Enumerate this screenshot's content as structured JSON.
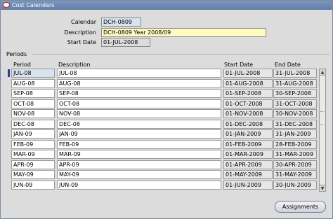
{
  "window": {
    "title": "Cost Calendars"
  },
  "form": {
    "calendar_label": "Calendar",
    "calendar_value": "DCH-0809",
    "description_label": "Description",
    "description_value": "DCH-0809 Year 2008/09",
    "start_date_label": "Start Date",
    "start_date_value": "01-JUL-2008"
  },
  "periods": {
    "section_label": "Periods",
    "columns": [
      "Period",
      "Description",
      "Start Date",
      "End Date"
    ],
    "rows": [
      {
        "period": "JUL-08",
        "description": "JUL-08",
        "start": "01-JUL-2008",
        "end": "31-JUL-2008"
      },
      {
        "period": "AUG-08",
        "description": "AUG-08",
        "start": "01-AUG-2008",
        "end": "31-AUG-2008"
      },
      {
        "period": "SEP-08",
        "description": "SEP-08",
        "start": "01-SEP-2008",
        "end": "30-SEP-2008"
      },
      {
        "period": "OCT-08",
        "description": "OCT-08",
        "start": "01-OCT-2008",
        "end": "31-OCT-2008"
      },
      {
        "period": "NOV-08",
        "description": "NOV-08",
        "start": "01-NOV-2008",
        "end": "30-NOV-2008"
      },
      {
        "period": "DEC-08",
        "description": "DEC-08",
        "start": "01-DEC-2008",
        "end": "31-DEC-2008"
      },
      {
        "period": "JAN-09",
        "description": "JAN-09",
        "start": "01-JAN-2009",
        "end": "31-JAN-2009"
      },
      {
        "period": "FEB-09",
        "description": "FEB-09",
        "start": "01-FEB-2009",
        "end": "28-FEB-2009"
      },
      {
        "period": "MAR-09",
        "description": "MAR-09",
        "start": "01-MAR-2009",
        "end": "31-MAR-2009"
      },
      {
        "period": "APR-09",
        "description": "APR-09",
        "start": "01-APR-2009",
        "end": "30-APR-2009"
      },
      {
        "period": "MAY-09",
        "description": "MAY-09",
        "start": "01-MAY-2009",
        "end": "31-MAY-2009"
      },
      {
        "period": "JUN-09",
        "description": "JUN-09",
        "start": "01-JUN-2009",
        "end": "30-JUN-2009"
      }
    ]
  },
  "buttons": {
    "assignments_label": "Assignments"
  },
  "icons": {
    "window": "oracle-icon",
    "scroll_up": "scroll-up-icon",
    "scroll_down": "scroll-down-icon"
  }
}
